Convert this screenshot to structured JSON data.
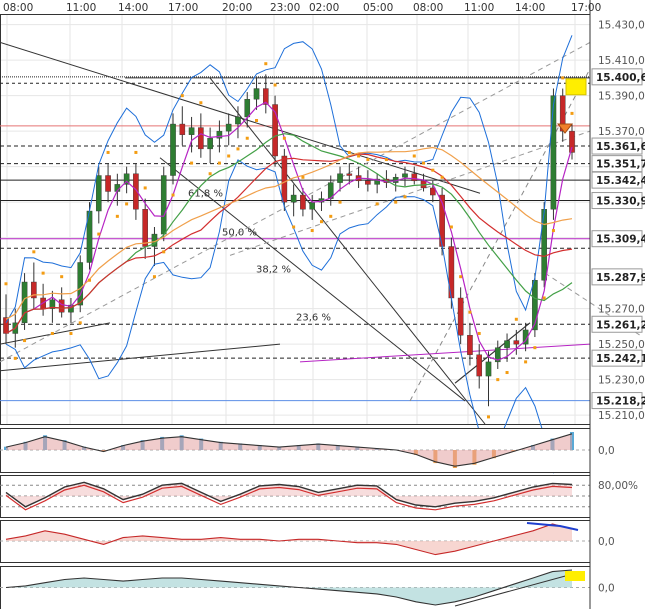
{
  "chart_data": {
    "type": "candlestick",
    "main_panel": {
      "x_tick_labels": [
        "08:00",
        "11:00",
        "14:00",
        "17:00",
        "20:00",
        "23:00",
        "02:00",
        "05:00",
        "08:00",
        "11:00",
        "14:00",
        "17:00"
      ],
      "y_ticks": [
        "15.430,0",
        "15.410,0",
        "15.390,0",
        "15.370,0",
        "15.270,0",
        "15.250,0",
        "15.230,0",
        "15.210,0"
      ],
      "ylim": [
        15205,
        15436
      ],
      "price_badges": [
        {
          "label": "15.400,6",
          "value": 15400.6
        },
        {
          "label": "15.361,6",
          "value": 15361.6
        },
        {
          "label": "15.351,7",
          "value": 15351.7
        },
        {
          "label": "15.342,4",
          "value": 15342.4
        },
        {
          "label": "15.330,9",
          "value": 15330.9
        },
        {
          "label": "15.309,4",
          "value": 15309.4
        },
        {
          "label": "15.287,9",
          "value": 15287.9
        },
        {
          "label": "15.261,2",
          "value": 15261.2
        },
        {
          "label": "15.242,1",
          "value": 15242.1
        },
        {
          "label": "15.218,2",
          "value": 15218.2
        }
      ],
      "fib_labels": [
        {
          "label": "61,8 %",
          "value": 15331
        },
        {
          "label": "50,0 %",
          "value": 15309
        },
        {
          "label": "38,2 %",
          "value": 15288
        },
        {
          "label": "23,6 %",
          "value": 15261
        }
      ],
      "candles_approx": [
        [
          15265,
          15278,
          15250,
          15256
        ],
        [
          15256,
          15270,
          15248,
          15262
        ],
        [
          15262,
          15290,
          15258,
          15285
        ],
        [
          15285,
          15296,
          15270,
          15276
        ],
        [
          15276,
          15284,
          15266,
          15270
        ],
        [
          15270,
          15280,
          15262,
          15275
        ],
        [
          15275,
          15282,
          15265,
          15268
        ],
        [
          15268,
          15276,
          15262,
          15272
        ],
        [
          15272,
          15300,
          15268,
          15296
        ],
        [
          15296,
          15330,
          15292,
          15325
        ],
        [
          15325,
          15350,
          15318,
          15345
        ],
        [
          15345,
          15352,
          15330,
          15336
        ],
        [
          15336,
          15346,
          15328,
          15340
        ],
        [
          15340,
          15350,
          15335,
          15346
        ],
        [
          15346,
          15352,
          15320,
          15326
        ],
        [
          15326,
          15332,
          15298,
          15305
        ],
        [
          15305,
          15316,
          15294,
          15312
        ],
        [
          15312,
          15350,
          15308,
          15345
        ],
        [
          15345,
          15380,
          15340,
          15374
        ],
        [
          15374,
          15384,
          15362,
          15368
        ],
        [
          15368,
          15378,
          15358,
          15372
        ],
        [
          15372,
          15380,
          15355,
          15360
        ],
        [
          15360,
          15372,
          15352,
          15366
        ],
        [
          15366,
          15376,
          15358,
          15370
        ],
        [
          15370,
          15380,
          15362,
          15374
        ],
        [
          15374,
          15384,
          15366,
          15378
        ],
        [
          15378,
          15392,
          15372,
          15388
        ],
        [
          15388,
          15400,
          15382,
          15394
        ],
        [
          15394,
          15402,
          15380,
          15385
        ],
        [
          15385,
          15390,
          15350,
          15356
        ],
        [
          15356,
          15360,
          15325,
          15330
        ],
        [
          15330,
          15340,
          15322,
          15334
        ],
        [
          15334,
          15338,
          15322,
          15326
        ],
        [
          15326,
          15334,
          15320,
          15330
        ],
        [
          15330,
          15336,
          15325,
          15332
        ],
        [
          15332,
          15345,
          15328,
          15341
        ],
        [
          15341,
          15350,
          15336,
          15346
        ],
        [
          15346,
          15352,
          15340,
          15345
        ],
        [
          15345,
          15350,
          15338,
          15342
        ],
        [
          15342,
          15348,
          15336,
          15340
        ],
        [
          15340,
          15346,
          15335,
          15343
        ],
        [
          15343,
          15348,
          15338,
          15341
        ],
        [
          15341,
          15346,
          15336,
          15344
        ],
        [
          15344,
          15350,
          15339,
          15346
        ],
        [
          15346,
          15350,
          15340,
          15342
        ],
        [
          15342,
          15346,
          15336,
          15338
        ],
        [
          15338,
          15342,
          15330,
          15334
        ],
        [
          15334,
          15338,
          15300,
          15305
        ],
        [
          15305,
          15310,
          15270,
          15276
        ],
        [
          15276,
          15282,
          15250,
          15255
        ],
        [
          15255,
          15262,
          15238,
          15244
        ],
        [
          15244,
          15250,
          15225,
          15232
        ],
        [
          15232,
          15246,
          15215,
          15240
        ],
        [
          15240,
          15252,
          15236,
          15248
        ],
        [
          15248,
          15256,
          15240,
          15252
        ],
        [
          15252,
          15258,
          15244,
          15250
        ],
        [
          15250,
          15262,
          15246,
          15258
        ],
        [
          15258,
          15290,
          15254,
          15286
        ],
        [
          15286,
          15330,
          15282,
          15326
        ],
        [
          15326,
          15394,
          15320,
          15390
        ],
        [
          15390,
          15394,
          15364,
          15370
        ],
        [
          15370,
          15374,
          15354,
          15358
        ]
      ]
    },
    "indicator_panels": [
      {
        "id": "histogram",
        "y_label": "0,0",
        "series_values_approx": [
          0.2,
          0.5,
          0.9,
          0.6,
          0.2,
          -0.1,
          0.3,
          0.6,
          0.8,
          0.9,
          0.7,
          0.5,
          0.4,
          0.3,
          0.2,
          0.3,
          0.4,
          0.3,
          0.2,
          0.1,
          0.0,
          -0.3,
          -0.8,
          -1.1,
          -0.9,
          -0.5,
          -0.1,
          0.3,
          0.7,
          1.1
        ]
      },
      {
        "id": "oscillator",
        "y_label": "80,00%",
        "series_values_approx": [
          60,
          20,
          45,
          75,
          88,
          70,
          40,
          55,
          80,
          85,
          60,
          35,
          55,
          78,
          82,
          76,
          60,
          70,
          80,
          78,
          40,
          25,
          20,
          30,
          35,
          45,
          60,
          75,
          85,
          82
        ]
      },
      {
        "id": "momentum",
        "y_label": "0,0",
        "series_values_approx": [
          0.1,
          0.3,
          0.6,
          0.4,
          0.1,
          -0.2,
          0.2,
          0.3,
          0.2,
          0.1,
          0.1,
          0.2,
          0.1,
          0.1,
          0.0,
          0.1,
          0.1,
          0.0,
          -0.1,
          -0.1,
          -0.2,
          -0.5,
          -0.8,
          -0.6,
          -0.3,
          0.0,
          0.3,
          0.6,
          1.0,
          0.7
        ]
      },
      {
        "id": "accumulation",
        "y_label": "0,0",
        "series_values_approx": [
          0.0,
          0.1,
          0.3,
          0.5,
          0.6,
          0.5,
          0.4,
          0.5,
          0.6,
          0.6,
          0.5,
          0.4,
          0.3,
          0.2,
          0.1,
          0.0,
          -0.1,
          -0.2,
          -0.3,
          -0.4,
          -0.6,
          -0.9,
          -1.1,
          -0.9,
          -0.6,
          -0.2,
          0.2,
          0.6,
          1.0,
          1.1
        ]
      }
    ],
    "colors": {
      "frame": "#333333",
      "grid": "#e6e6e6",
      "candle_up": "#2e7d32",
      "candle_down": "#c62828",
      "bollinger": "#1e6fd9",
      "ma_red": "#d32f2f",
      "ma_orange": "#f0a04b",
      "ma_green": "#43a047",
      "ma_magenta": "#b624c4",
      "psar": "#f39c12",
      "highlight": "#ffee00",
      "level_red": "#e57373",
      "level_blue": "#5c8ee6"
    }
  }
}
